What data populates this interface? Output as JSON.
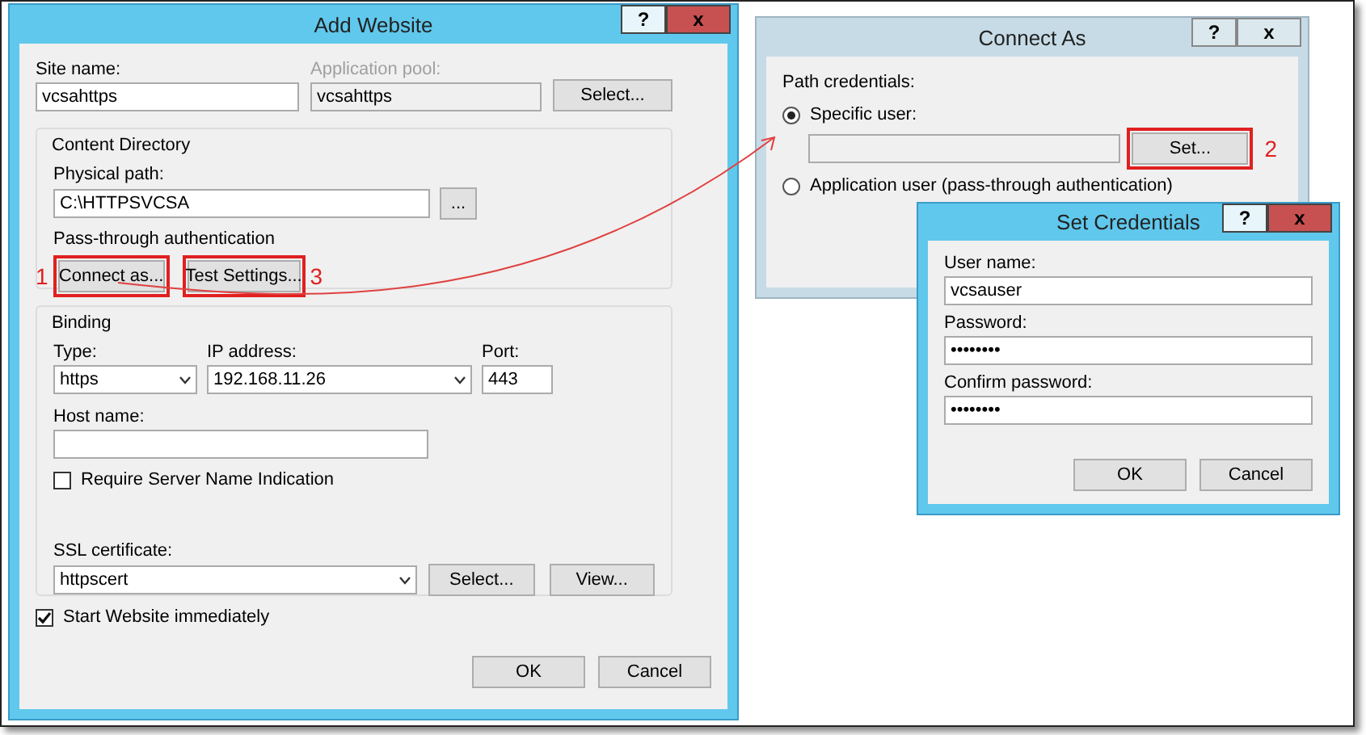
{
  "add_website": {
    "title": "Add Website",
    "help_button": "?",
    "close_button": "x",
    "site_name": {
      "label": "Site name:",
      "value": "vcsahttps"
    },
    "app_pool": {
      "label": "Application pool:",
      "value": "vcsahttps",
      "disabled": true
    },
    "select_button": "Select...",
    "content_directory": {
      "title": "Content Directory",
      "path_label": "Physical path:",
      "path_value": "C:\\HTTPSVCSA",
      "browse_button": "...",
      "pass_through": "Pass-through authentication",
      "buttons": [
        {
          "label": "Connect as...",
          "highlighted": true,
          "step": "1"
        },
        {
          "label": "Test Settings...",
          "highlighted": true,
          "step": "3"
        }
      ]
    },
    "binding": {
      "title": "Binding",
      "type_label": "Type:",
      "type_value": "https",
      "ip_label": "IP address:",
      "ip_value": "192.168.11.26",
      "port_label": "Port:",
      "port_value": "443",
      "host_label": "Host name:",
      "sni": {
        "label": "Require Server Name Indication",
        "checked": false
      },
      "ssl_label": "SSL certificate:",
      "ssl_value": "httpscert",
      "select_button": "Select...",
      "view_button": "View..."
    },
    "start_immediately": {
      "label": "Start Website immediately",
      "checked": true
    },
    "ok_button": "OK",
    "cancel_button": "Cancel"
  },
  "connect_as": {
    "title": "Connect As",
    "help_button": "?",
    "close_button": "x",
    "section_label": "Path credentials:",
    "options": [
      {
        "label": "Specific user:",
        "selected": true
      },
      {
        "label": "Application user (pass-through authentication)",
        "selected": false
      }
    ],
    "set_button": {
      "label": "Set...",
      "highlighted": true,
      "step": "2"
    }
  },
  "set_credentials": {
    "title": "Set Credentials",
    "help_button": "?",
    "close_button": "x",
    "fields": [
      {
        "label": "User name:",
        "value": "vcsauser"
      },
      {
        "label": "Password:",
        "value": "••••••••"
      },
      {
        "label": "Confirm password:",
        "value": "••••••••"
      }
    ],
    "ok_button": "OK",
    "cancel_button": "Cancel"
  }
}
